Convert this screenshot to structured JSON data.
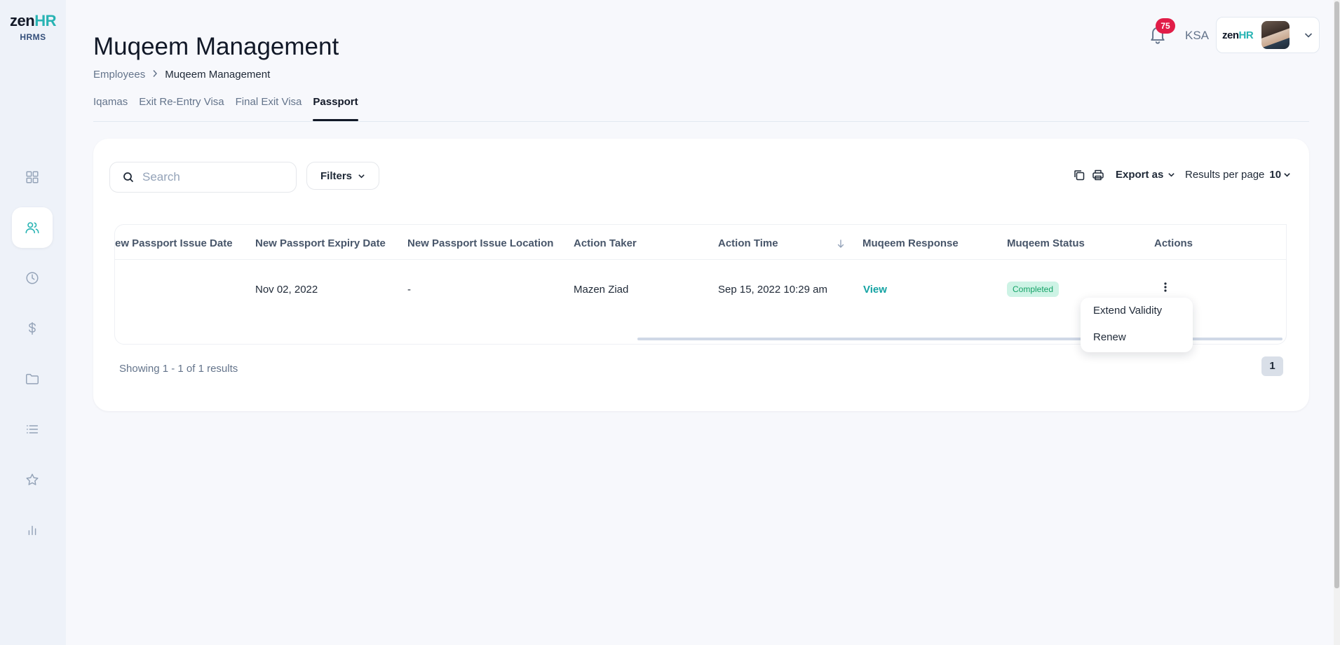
{
  "brand": {
    "word_left": "zen",
    "word_right": "HR",
    "sub": "HRMS"
  },
  "page": {
    "title": "Muqeem Management"
  },
  "breadcrumb": {
    "parent": "Employees",
    "separator": ">",
    "current": "Muqeem Management"
  },
  "tabs": [
    {
      "label": "Iqamas",
      "active": false
    },
    {
      "label": "Exit Re-Entry Visa",
      "active": false
    },
    {
      "label": "Final Exit Visa",
      "active": false
    },
    {
      "label": "Passport",
      "active": true
    }
  ],
  "header": {
    "notification_count": "75",
    "region": "KSA"
  },
  "sidebar": {
    "items": [
      {
        "icon": "dashboard-icon",
        "active": false
      },
      {
        "icon": "users-icon",
        "active": true
      },
      {
        "icon": "clock-icon",
        "active": false
      },
      {
        "icon": "dollar-icon",
        "active": false
      },
      {
        "icon": "folder-icon",
        "active": false
      },
      {
        "icon": "list-icon",
        "active": false
      },
      {
        "icon": "star-icon",
        "active": false
      },
      {
        "icon": "chart-icon",
        "active": false
      }
    ]
  },
  "toolbar": {
    "search_placeholder": "Search",
    "filters_label": "Filters",
    "export_label": "Export as",
    "results_per_page_label": "Results per page",
    "results_per_page_value": "10"
  },
  "table": {
    "columns": [
      "ew Passport Issue Date",
      "New Passport Expiry Date",
      "New Passport Issue Location",
      "Action Taker",
      "Action Time",
      "Muqeem Response",
      "Muqeem Status",
      "Actions"
    ],
    "rows": [
      {
        "issue_date": "",
        "expiry_date": "Nov 02, 2022",
        "issue_location": "-",
        "action_taker": "Mazen Ziad",
        "action_time": "Sep 15, 2022 10:29 am",
        "response": "View",
        "status": "Completed"
      }
    ]
  },
  "pagination": {
    "showing": "Showing 1 - 1 of 1 results",
    "current_page": "1"
  },
  "row_menu": {
    "items": [
      "Extend Validity",
      "Renew"
    ]
  },
  "colors": {
    "accent": "#27b3b3",
    "badge": "#e11d48",
    "status_bg": "#cdf3e5",
    "status_text": "#16a368"
  }
}
